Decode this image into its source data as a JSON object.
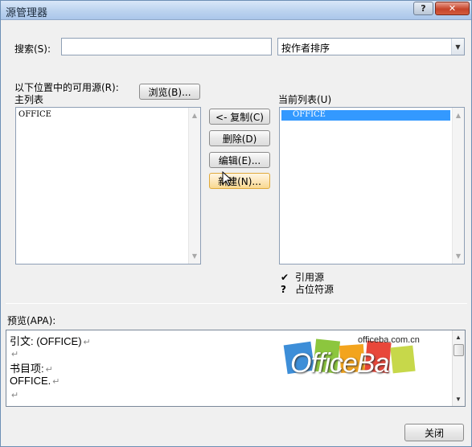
{
  "window": {
    "title": "源管理器",
    "help_label": "?",
    "close_label": "✕"
  },
  "search": {
    "label": "搜索(S):",
    "value": "",
    "sort_selected": "按作者排序"
  },
  "master": {
    "available_label": "以下位置中的可用源(R):",
    "browse_label": "浏览(B)...",
    "list_label": "主列表",
    "items": [
      "OFFICE"
    ]
  },
  "actions": {
    "copy_label": "<- 复制(C)",
    "delete_label": "删除(D)",
    "edit_label": "编辑(E)...",
    "new_label": "新建(N)..."
  },
  "current": {
    "list_label": "当前列表(U)",
    "items": [
      "OFFICE"
    ],
    "legend": [
      {
        "symbol": "✔",
        "text": "引用源"
      },
      {
        "symbol": "?",
        "text": "占位符源"
      }
    ]
  },
  "preview": {
    "label": "预览(APA):",
    "lines": [
      "引文:  (OFFICE)",
      "",
      "书目项:",
      "OFFICE.",
      ""
    ],
    "para_mark": "↵"
  },
  "watermark": {
    "brand": "OfficeBa",
    "domain": "officeba.com.cn"
  },
  "footer": {
    "close_label": "关闭"
  },
  "colors": {
    "selection": "#3399ff",
    "hover_border": "#e0a93a"
  }
}
